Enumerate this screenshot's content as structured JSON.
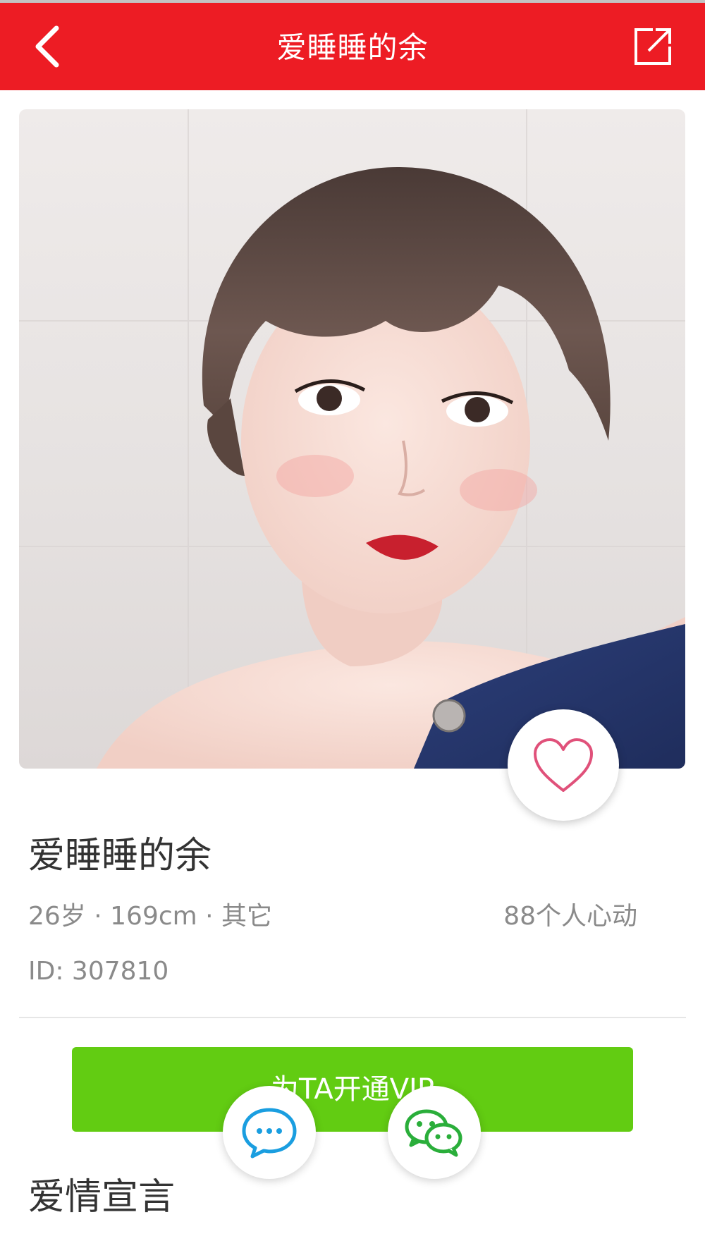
{
  "header": {
    "title": "爱睡睡的余",
    "back_icon": "chevron-left-icon",
    "share_icon": "share-external-icon",
    "background_color": "#ed1c24"
  },
  "profile": {
    "photo_alt": "profile-photo",
    "name": "爱睡睡的余",
    "meta": "26岁 · 169cm · 其它",
    "likes": "88个人心动",
    "id": "ID: 307810",
    "like_icon": "heart-outline-icon"
  },
  "actions": {
    "vip_label": "为TA开通VIP",
    "vip_color": "#62cc12",
    "chat_icon": "chat-bubble-icon",
    "wechat_icon": "wechat-icon"
  },
  "sections": {
    "love_declaration_title": "爱情宣言"
  }
}
